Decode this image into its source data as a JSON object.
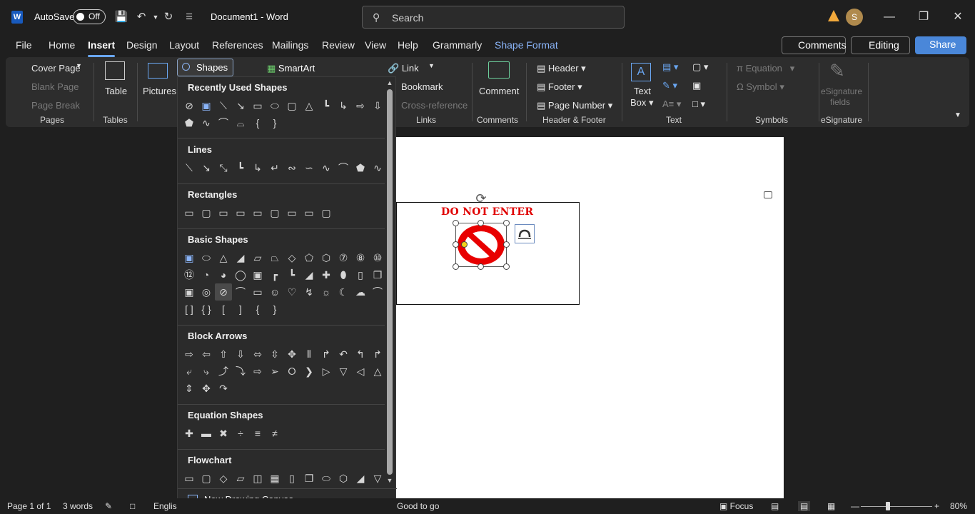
{
  "titlebar": {
    "autosave_label": "AutoSave",
    "autosave_state": "Off",
    "doc_title": "Document1  -  Word",
    "search_placeholder": "Search",
    "avatar_initial": "S"
  },
  "tabs": [
    "File",
    "Home",
    "Insert",
    "Design",
    "Layout",
    "References",
    "Mailings",
    "Review",
    "View",
    "Help",
    "Grammarly",
    "Shape Format"
  ],
  "active_tab": "Insert",
  "topright": {
    "comments": "Comments",
    "editing": "Editing",
    "share": "Share"
  },
  "ribbon": {
    "pages": {
      "cover_page": "Cover Page",
      "blank_page": "Blank Page",
      "page_break": "Page Break",
      "label": "Pages"
    },
    "tables": {
      "table": "Table",
      "label": "Tables"
    },
    "illustrations": {
      "pictures": "Pictures",
      "shapes": "Shapes",
      "smartart": "SmartArt"
    },
    "links": {
      "link": "Link",
      "bookmark": "Bookmark",
      "cross_reference": "Cross-reference",
      "label": "Links"
    },
    "comments": {
      "comment": "Comment",
      "label": "Comments"
    },
    "header_footer": {
      "header": "Header",
      "footer": "Footer",
      "page_number": "Page Number",
      "label": "Header & Footer"
    },
    "text": {
      "text_box_1": "Text",
      "text_box_2": "Box",
      "label": "Text"
    },
    "symbols": {
      "equation": "Equation",
      "symbol": "Symbol",
      "label": "Symbols"
    },
    "esignature": {
      "line1": "eSignature",
      "line2": "fields",
      "label": "eSignature"
    }
  },
  "shapes_gallery": {
    "sections": {
      "recent": "Recently Used Shapes",
      "lines": "Lines",
      "rectangles": "Rectangles",
      "basic": "Basic Shapes",
      "block_arrows": "Block Arrows",
      "equation": "Equation Shapes",
      "flowchart": "Flowchart"
    },
    "new_drawing_canvas": "New Drawing Canvas"
  },
  "document": {
    "sign_text": "DO NOT ENTER"
  },
  "status": {
    "page": "Page 1 of 1",
    "words": "3 words",
    "language": "Englis",
    "tip": "Good to go",
    "focus": "Focus",
    "zoom": "80%"
  }
}
